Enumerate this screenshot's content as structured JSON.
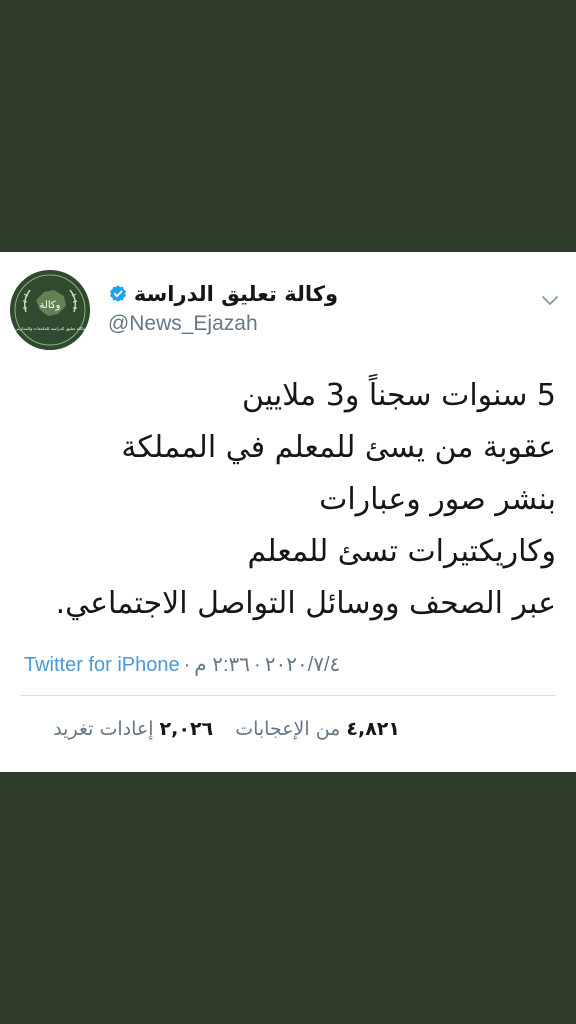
{
  "tweet": {
    "author_name": "وكالة تعليق الدراسة",
    "handle": "@News_Ejazah",
    "avatar_text_top": "وكالة",
    "avatar_text_bottom": "وكالة تعليق الدراسة للجامعات والمدارس",
    "lines": [
      "5 سنوات سجناً و3 ملايين",
      "عقوبة من يسئ للمعلم في المملكة",
      "بنشر صور وعبارات",
      "وكاريكتيرات تسئ للمعلم",
      "عبر الصحف ووسائل التواصل الاجتماعي."
    ],
    "time": "٢:٣٦ م",
    "date": "٢٠٢٠/٧/٤",
    "source": "Twitter for iPhone",
    "retweets_count": "٢,٠٢٦",
    "retweets_label": "إعادات تغريد",
    "likes_count": "٤,٨٢١",
    "likes_label": "من الإعجابات"
  },
  "colors": {
    "background": "#2f3d2b",
    "verified": "#1da1f2",
    "link": "#4a99d8",
    "muted": "#657786"
  }
}
